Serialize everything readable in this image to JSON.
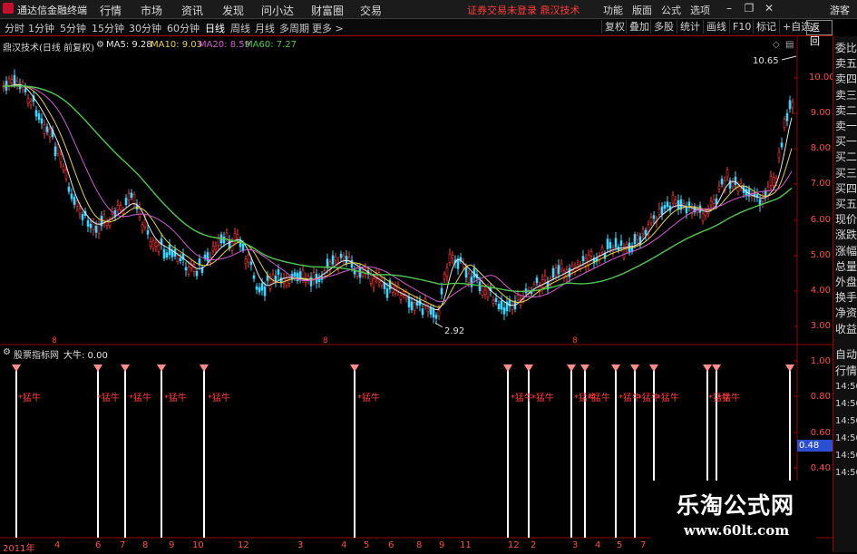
{
  "app": {
    "title": "通达信金融终端",
    "menus": [
      "行情",
      "市场",
      "资讯",
      "发现",
      "问小达",
      "财富圈",
      "交易"
    ],
    "notice": "证券交易未登录  鼎汉技术",
    "right_menus": [
      "功能",
      "版面",
      "公式",
      "选项"
    ],
    "user": "游客",
    "window_buttons": [
      "minimize-icon",
      "restore-icon",
      "close-icon"
    ]
  },
  "toolbar": {
    "periods": [
      "分时",
      "1分钟",
      "5分钟",
      "15分钟",
      "30分钟",
      "60分钟",
      "日线",
      "周线",
      "月线",
      "多周期",
      "更多 >"
    ],
    "active_period": "日线",
    "tools": [
      "复权",
      "叠加",
      "多股",
      "统计",
      "画线",
      "F10",
      "标记",
      "+自选",
      "返回"
    ]
  },
  "main_chart": {
    "stock_label": "鼎汉技术(日线 前复权)",
    "ma": [
      {
        "label": "MA5: 9.28",
        "color": "#e6e6e6"
      },
      {
        "label": "MA10: 9.03",
        "color": "#e8d24a"
      },
      {
        "label": "MA20: 8.59",
        "color": "#d25ad2"
      },
      {
        "label": "MA60: 7.27",
        "color": "#4ec94e"
      }
    ],
    "y_ticks": [
      "10.00",
      "9.00",
      "8.00",
      "7.00",
      "6.00",
      "5.00",
      "4.00",
      "3.00"
    ],
    "high_label": "10.65",
    "low_label": "2.92"
  },
  "indicator": {
    "title": "股票指标网",
    "value_label": "大牛: 0.00",
    "signal_text": "*猛牛",
    "y_ticks": [
      "1.00",
      "0.80",
      "0.60",
      "0.40"
    ],
    "current_value": "0.48"
  },
  "right_panel": {
    "items": [
      "委比",
      "卖五",
      "卖四",
      "卖三",
      "卖二",
      "卖一",
      "买一",
      "买二",
      "买三",
      "买四",
      "买五",
      "现价",
      "涨跌",
      "涨幅",
      "总量",
      "外盘",
      "换手",
      "净资",
      "收益"
    ],
    "lower_items": [
      "自动",
      "行情"
    ],
    "times": [
      "14:50",
      "14:50",
      "14:50",
      "14:50",
      "14:50",
      "14:50"
    ]
  },
  "x_axis": [
    "2011年",
    "4",
    "6",
    "7",
    "8",
    "9",
    "10",
    "12",
    "3",
    "4",
    "5",
    "6",
    "8",
    "9",
    "11",
    "12",
    "2",
    "3",
    "4",
    "5",
    "7"
  ],
  "watermark": {
    "line1": "乐淘公式网",
    "line2": "www.60lt.com"
  },
  "colors": {
    "up": "#ff3b3b",
    "down": "#3bd6ff",
    "axis": "#b00000"
  }
}
